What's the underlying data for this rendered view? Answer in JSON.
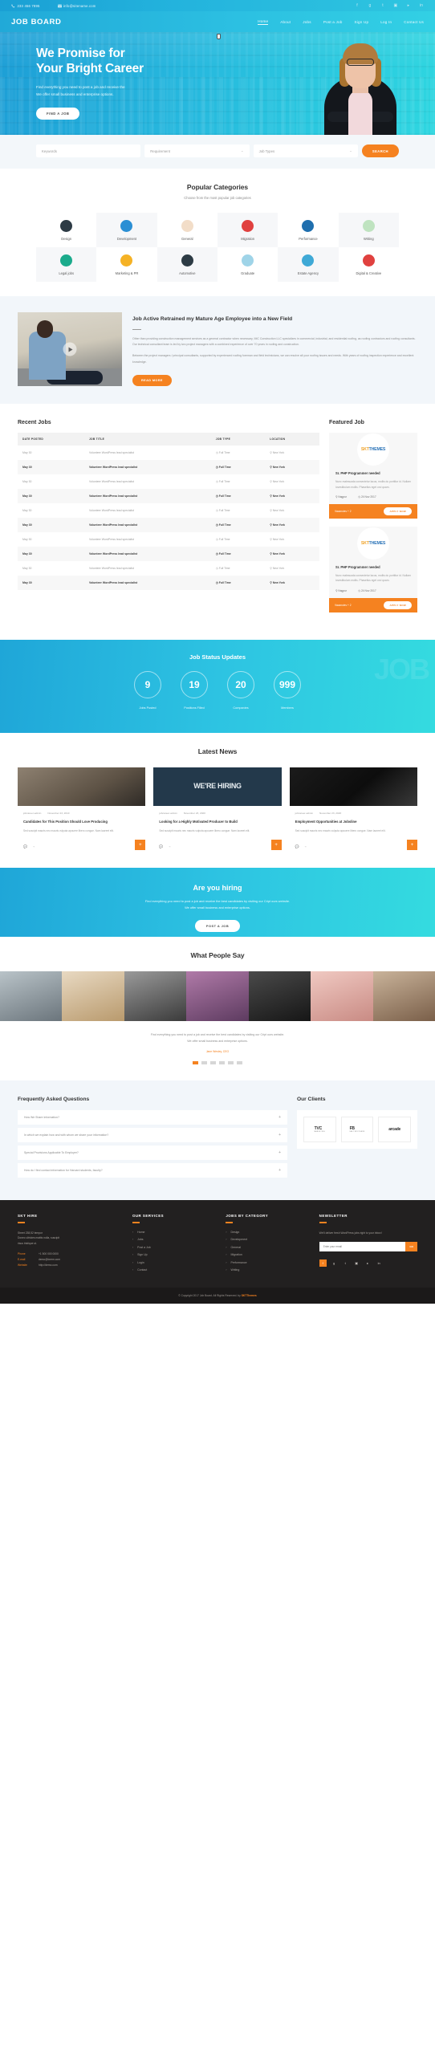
{
  "topbar": {
    "phone": "233 456 7895",
    "email": "info@sitename.com",
    "socials": [
      "facebook",
      "google-plus",
      "twitter",
      "instagram",
      "youtube",
      "linkedin"
    ]
  },
  "nav": {
    "logo": "JOB BOARD",
    "items": [
      {
        "label": "Home",
        "active": true
      },
      {
        "label": "About",
        "active": false
      },
      {
        "label": "Jobs",
        "active": false
      },
      {
        "label": "Post a Job",
        "active": false
      },
      {
        "label": "Sign Up",
        "active": false
      },
      {
        "label": "Log In",
        "active": false
      },
      {
        "label": "Contact Us",
        "active": false
      }
    ]
  },
  "hero": {
    "title_line1": "We Promise for",
    "title_line2": "Your Bright Career",
    "desc_line1": "Find everything you need to post a job and receive the",
    "desc_line2": "We offer small business and enterprise options.",
    "cta": "FIND A JOB"
  },
  "search": {
    "keywords_placeholder": "Keywords",
    "requirement": "Requirement",
    "job_types": "Job Types",
    "button": "SEARCH"
  },
  "categories": {
    "title": "Popular Categories",
    "subtitle": "Choose from the most popular job categories",
    "items": [
      {
        "label": "Design",
        "color": "#2d3b45"
      },
      {
        "label": "Development",
        "color": "#2b8fd4"
      },
      {
        "label": "General",
        "color": "#f2ddc8"
      },
      {
        "label": "Migration",
        "color": "#e0413f"
      },
      {
        "label": "Performance",
        "color": "#1f6fae"
      },
      {
        "label": "Writing",
        "color": "#bfe3c0"
      },
      {
        "label": "Legal jobs",
        "color": "#1bab8c"
      },
      {
        "label": "Marketing & PR",
        "color": "#f5b225"
      },
      {
        "label": "Automotive",
        "color": "#2d3b45"
      },
      {
        "label": "Graduate",
        "color": "#9fd4e8"
      },
      {
        "label": "Estate Agency",
        "color": "#3fa9d6"
      },
      {
        "label": "Digital & Creative",
        "color": "#e0413f"
      }
    ]
  },
  "article": {
    "title": "Job Active Retrained my Mature Age Employee into a New Field",
    "p1": "Other than providing construction management services as a general contractor when necessary, IMC Construction LLC specializes in commercial, industrial, and residential roofing, as roofing contractors and roofing consultants. Our technical consultant team is led by two project managers with a combined experience of over 70 years in roofing and construction.",
    "p2": "Between the project managers / principal consultants, supported by experienced roofing foreman and field technicians, we can resolve all your roofing issues and needs. With years of roofing inspection experience and excellent knowledge.",
    "cta": "READ MORE"
  },
  "recent_jobs": {
    "title": "Recent Jobs",
    "columns": [
      "DATE POSTED",
      "JOB TITLE",
      "JOB TYPE",
      "LOCATION"
    ],
    "rows": [
      {
        "date": "May 30",
        "title": "Volunteer WordPress lead specialist",
        "type": "Full Time",
        "location": "New York"
      },
      {
        "date": "May 30",
        "title": "Volunteer WordPress lead specialist",
        "type": "Full Time",
        "location": "New York"
      },
      {
        "date": "May 30",
        "title": "Volunteer WordPress lead specialist",
        "type": "Full Time",
        "location": "New York"
      },
      {
        "date": "May 30",
        "title": "Volunteer WordPress lead specialist",
        "type": "Full Time",
        "location": "New York"
      },
      {
        "date": "May 30",
        "title": "Volunteer WordPress lead specialist",
        "type": "Full Time",
        "location": "New York"
      },
      {
        "date": "May 30",
        "title": "Volunteer WordPress lead specialist",
        "type": "Full Time",
        "location": "New York"
      },
      {
        "date": "May 30",
        "title": "Volunteer WordPress lead specialist",
        "type": "Full Time",
        "location": "New York"
      },
      {
        "date": "May 30",
        "title": "Volunteer WordPress lead specialist",
        "type": "Full Time",
        "location": "New York"
      },
      {
        "date": "May 30",
        "title": "Volunteer WordPress lead specialist",
        "type": "Full Time",
        "location": "New York"
      },
      {
        "date": "May 30",
        "title": "Volunteer WordPress lead specialist",
        "type": "Full Time",
        "location": "New York"
      }
    ]
  },
  "featured": {
    "title": "Featured Job",
    "logo_a": "SKT",
    "logo_b": "THEMES",
    "cards": [
      {
        "title": "Sr. PHP Programmer needed",
        "desc": "Nunc malesuada consectetur lacus, mollis du porttitor id. Nullam lovestibulum mollis. Phasellus eget orci quam.",
        "location": "Nagpur",
        "date": "24 Nov 2017",
        "vacancies": "Vacancies + 2",
        "apply": "APPLY NOW"
      },
      {
        "title": "Sr. PHP Programmer needed",
        "desc": "Nunc malesuada consectetur lacus, mollis du porttitor id. Nullam lovestibulum mollis. Phasellus eget orci quam.",
        "location": "Nagpur",
        "date": "24 Nov 2017",
        "vacancies": "Vacancies + 2",
        "apply": "APPLY NOW"
      }
    ]
  },
  "status": {
    "title": "Job Status Updates",
    "ghost": "JOB",
    "items": [
      {
        "value": "9",
        "label": "Jobs Posted"
      },
      {
        "value": "19",
        "label": "Positions Filled"
      },
      {
        "value": "20",
        "label": "Companies"
      },
      {
        "value": "999",
        "label": "Members"
      }
    ]
  },
  "news": {
    "title": "Latest News",
    "hiring_text": "WE'RE HIRING",
    "cards": [
      {
        "author": "jobcareer-admin",
        "date": "November 23, 2010",
        "title": "Candidates for This Position Should Love Producing",
        "excerpt": "Sed suscipit mauris nec mauris vulputa apouere libero congue. Nam laoreet elit.",
        "plus": "+"
      },
      {
        "author": "jobcareer-admin",
        "date": "November 23, 2020",
        "title": "Looking for a Highly Motivated Producer to Build",
        "excerpt": "Sed suscipit mauris nec mauris vulputa apouere libero congue. Nam laoreet elit.",
        "plus": "+"
      },
      {
        "author": "jobcareer-admin",
        "date": "November 23, 2020",
        "title": "Employment Opportunities at Jobsline",
        "excerpt": "Sed suscipit mauris nec mauris vulputa apouere libero congue. Nam laoreet elit.",
        "plus": "+"
      }
    ]
  },
  "hiring": {
    "title": "Are you hiring",
    "desc_line1": "Find everything you need to post a job and receive the best candidates by visiting our Cript ours website.",
    "desc_line2": "We offer small business and enterprise options.",
    "cta": "POST A JOB"
  },
  "testimonial": {
    "title": "What People Say",
    "quote_line1": "Find everything you need to post a job and receive the best candidates by visiting our Cript ours website.",
    "quote_line2": "We offer small business and enterprise options.",
    "author": "Jane Wesley, CEO",
    "dots": 6,
    "active_dot": 0
  },
  "faq": {
    "title": "Frequently Asked Questions",
    "items": [
      {
        "q": "How We Share Information?",
        "toggle": "+"
      },
      {
        "q": "In which we explain how and with whom we share your information?",
        "toggle": "+"
      },
      {
        "q": "Special Provisions Applicable To Employer?",
        "toggle": "+"
      },
      {
        "q": "How do I find contact information for Harvard students, faculty?",
        "toggle": "+"
      }
    ]
  },
  "clients": {
    "title": "Our Clients",
    "logos": [
      {
        "name": "TVC",
        "sub": "MARKETING"
      },
      {
        "name": "FB",
        "sub": "FAST BROTHERS"
      },
      {
        "name": "arcade",
        "sub": ""
      }
    ]
  },
  "footer": {
    "col1": {
      "heading": "SKT HIRE",
      "address_line1": "Street 238,52 tempor",
      "address_line2": "Donec ultricies mattis nulla, suscipit",
      "address_line3": "risus tristique ut.",
      "rows": [
        {
          "k": "Phone",
          "v": "+1 500 000 0000"
        },
        {
          "k": "E-mail",
          "v": "demo@lorem.com"
        },
        {
          "k": "Website",
          "v": "http://demo.com"
        }
      ]
    },
    "col2": {
      "heading": "OUR SERVICES",
      "links": [
        "Home",
        "Jobs",
        "Post a Job",
        "Sign Up",
        "Login",
        "Contact"
      ]
    },
    "col3": {
      "heading": "JOBS BY CATEGORY",
      "links": [
        "Design",
        "Development",
        "General",
        "Migration",
        "Performance",
        "Writing"
      ]
    },
    "col4": {
      "heading": "NEWSLETTER",
      "desc": "We'll deliver fresh WordPress jobs right to your inbox!",
      "placeholder": "Enter your email",
      "button": "GO",
      "socials": [
        "facebook",
        "google-plus",
        "twitter",
        "instagram",
        "youtube",
        "linkedin"
      ]
    },
    "copyright_a": "© Copyright 2017  Job Board. All Rights Reserved.  by ",
    "copyright_b": "SKTThemes"
  }
}
